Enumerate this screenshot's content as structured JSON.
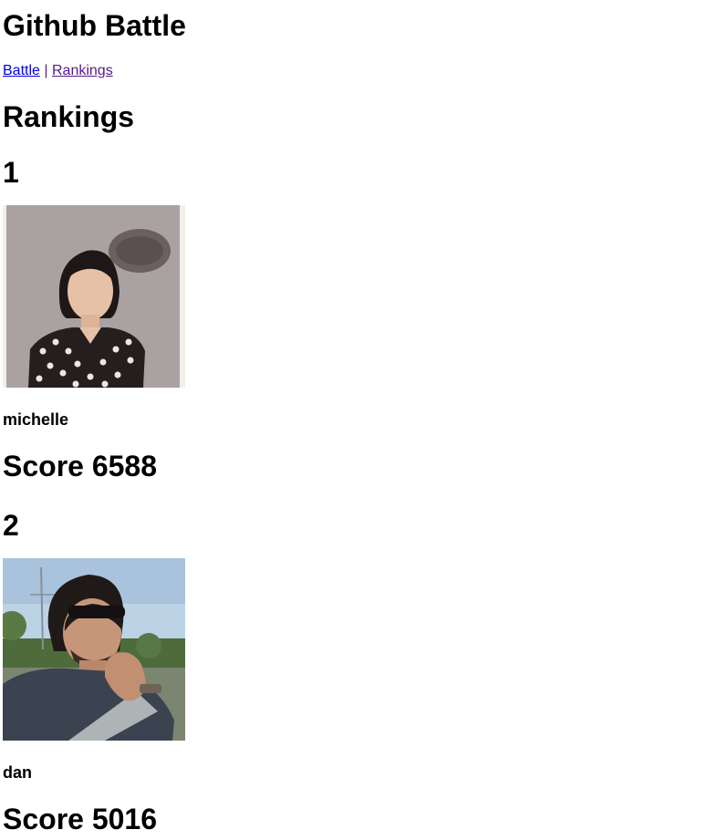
{
  "header": {
    "title": "Github Battle"
  },
  "nav": {
    "links": [
      {
        "label": "Battle"
      },
      {
        "label": "Rankings"
      }
    ],
    "separator": "|"
  },
  "main": {
    "title": "Rankings",
    "rankings": [
      {
        "rank": "1",
        "username": "michelle",
        "score": "Score 6588",
        "avatar_icon": "avatar-photo-michelle"
      },
      {
        "rank": "2",
        "username": "dan",
        "score": "Score 5016",
        "avatar_icon": "avatar-photo-dan"
      }
    ]
  }
}
